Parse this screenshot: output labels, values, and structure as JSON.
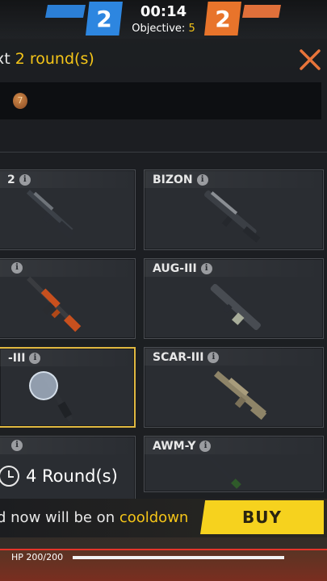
{
  "scoreboard": {
    "blue_score": "2",
    "orange_score": "2",
    "timer": "00:14",
    "objective_label": "Objective:",
    "objective_value": "5"
  },
  "panel": {
    "header_prefix": "xt ",
    "header_highlight": "2 round(s)",
    "coin_value": "7"
  },
  "weapons": [
    {
      "name": "2",
      "col": "left"
    },
    {
      "name": "BIZON",
      "col": "right"
    },
    {
      "name": "",
      "col": "left"
    },
    {
      "name": "AUG-III",
      "col": "right"
    },
    {
      "name": "-III",
      "col": "left"
    },
    {
      "name": "SCAR-III",
      "col": "right"
    },
    {
      "name": "",
      "col": "left"
    },
    {
      "name": "AWM-Y",
      "col": "right"
    }
  ],
  "rounds": {
    "text": "4 Round(s)"
  },
  "footer": {
    "cooldown_prefix": "d now will be on ",
    "cooldown_highlight": "cooldown",
    "buy_label": "BUY"
  },
  "hp": {
    "label": "HP 200/200"
  },
  "colors": {
    "blue": "#2d86e0",
    "orange": "#e8742b",
    "accent": "#f5c518",
    "buy": "#f6d21e"
  }
}
